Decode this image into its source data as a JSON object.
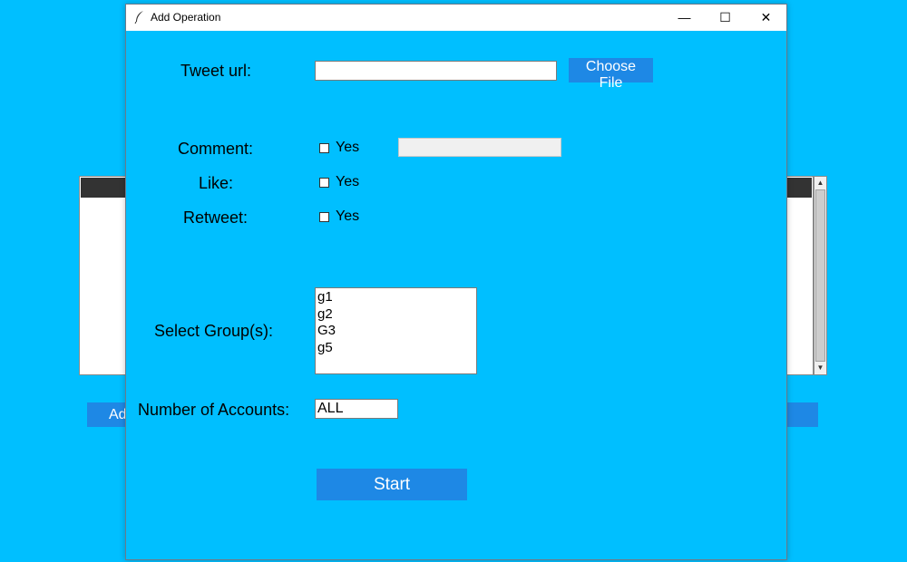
{
  "background": {
    "left_button_label": "Ad",
    "right_button_label": ""
  },
  "dialog": {
    "title": "Add Operation",
    "controls": {
      "minimize": "—",
      "maximize": "☐",
      "close": "✕"
    },
    "tweet_url": {
      "label": "Tweet url:",
      "value": "",
      "choose_file_label": "Choose File"
    },
    "comment": {
      "label": "Comment:",
      "checkbox_label": "Yes",
      "checked": false,
      "text_value": ""
    },
    "like": {
      "label": "Like:",
      "checkbox_label": "Yes",
      "checked": false
    },
    "retweet": {
      "label": "Retweet:",
      "checkbox_label": "Yes",
      "checked": false
    },
    "groups": {
      "label": "Select Group(s):",
      "items": [
        "g1",
        "g2",
        "G3",
        "g5"
      ]
    },
    "accounts": {
      "label": "Number of Accounts:",
      "value": "ALL"
    },
    "start_label": "Start"
  },
  "colors": {
    "background": "#00bfff",
    "button": "#1e88e5",
    "button_text": "#ffffff"
  }
}
